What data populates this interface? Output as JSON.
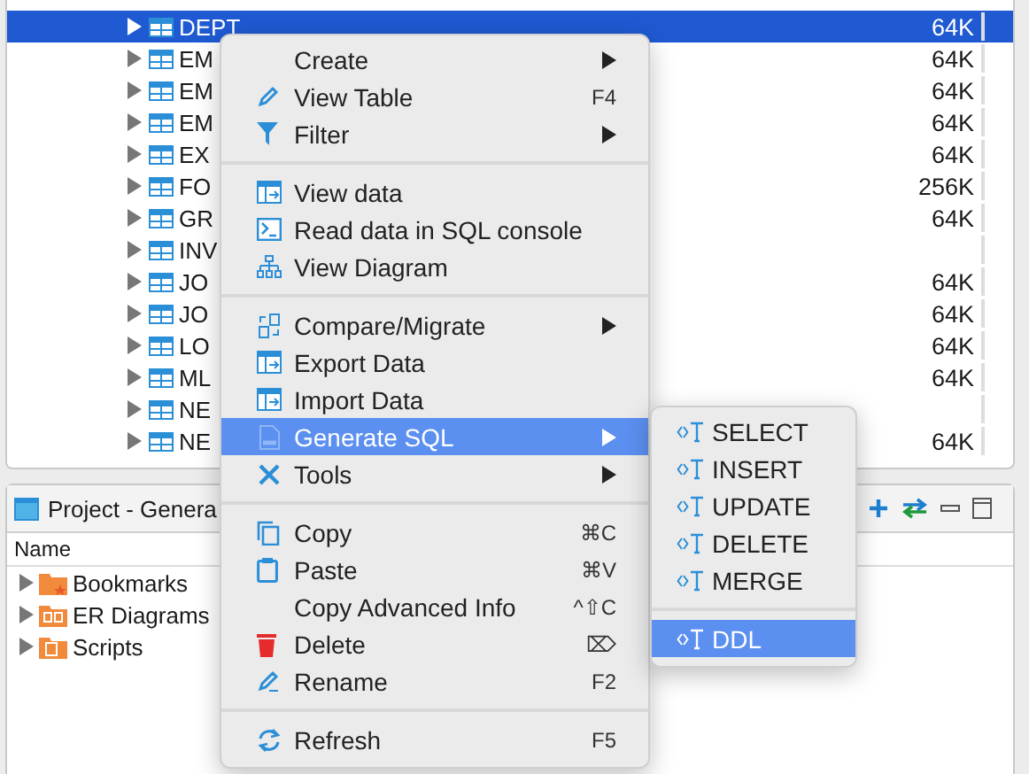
{
  "tables_panel": {
    "rows": [
      {
        "name": "DEPT",
        "size": "64K",
        "selected": true
      },
      {
        "name": "EM",
        "size": "64K",
        "selected": false
      },
      {
        "name": "EM",
        "size": "64K",
        "selected": false
      },
      {
        "name": "EM",
        "size": "64K",
        "selected": false
      },
      {
        "name": "EX",
        "size": "64K",
        "selected": false
      },
      {
        "name": "FO",
        "size": "256K",
        "selected": false
      },
      {
        "name": "GR",
        "size": "64K",
        "selected": false
      },
      {
        "name": "INV",
        "size": "",
        "selected": false
      },
      {
        "name": "JO",
        "size": "64K",
        "selected": false
      },
      {
        "name": "JO",
        "size": "64K",
        "selected": false
      },
      {
        "name": "LO",
        "size": "64K",
        "selected": false
      },
      {
        "name": "ML",
        "size": "64K",
        "selected": false
      },
      {
        "name": "NE",
        "size": "",
        "selected": false
      },
      {
        "name": "NE",
        "size": "64K",
        "selected": false
      }
    ]
  },
  "project_panel": {
    "title": "Project - Genera",
    "column": "Name",
    "items": [
      {
        "label": "Bookmarks"
      },
      {
        "label": "ER Diagrams"
      },
      {
        "label": "Scripts"
      }
    ]
  },
  "context_menu": {
    "items": [
      {
        "kind": "item",
        "label": "Create",
        "submenu": true,
        "selected": false
      },
      {
        "kind": "item",
        "label": "View Table",
        "shortcut": "F4",
        "selected": false
      },
      {
        "kind": "item",
        "label": "Filter",
        "submenu": true,
        "selected": false
      },
      {
        "kind": "separator"
      },
      {
        "kind": "item",
        "label": "View data",
        "selected": false
      },
      {
        "kind": "item",
        "label": "Read data in SQL console",
        "selected": false
      },
      {
        "kind": "item",
        "label": "View Diagram",
        "selected": false
      },
      {
        "kind": "separator"
      },
      {
        "kind": "item",
        "label": "Compare/Migrate",
        "submenu": true,
        "selected": false
      },
      {
        "kind": "item",
        "label": "Export Data",
        "selected": false
      },
      {
        "kind": "item",
        "label": "Import Data",
        "selected": false
      },
      {
        "kind": "item",
        "label": "Generate SQL",
        "submenu": true,
        "selected": true
      },
      {
        "kind": "item",
        "label": "Tools",
        "submenu": true,
        "selected": false
      },
      {
        "kind": "separator"
      },
      {
        "kind": "item",
        "label": "Copy",
        "shortcut": "⌘C",
        "selected": false
      },
      {
        "kind": "item",
        "label": "Paste",
        "shortcut": "⌘V",
        "selected": false
      },
      {
        "kind": "item",
        "label": "Copy Advanced Info",
        "shortcut": "^⇧C",
        "selected": false
      },
      {
        "kind": "item",
        "label": "Delete",
        "shortcut": "⌦",
        "selected": false
      },
      {
        "kind": "item",
        "label": "Rename",
        "shortcut": "F2",
        "selected": false
      },
      {
        "kind": "separator"
      },
      {
        "kind": "item",
        "label": "Refresh",
        "shortcut": "F5",
        "selected": false
      }
    ]
  },
  "submenu": {
    "items": [
      {
        "kind": "item",
        "label": "SELECT",
        "selected": false
      },
      {
        "kind": "item",
        "label": "INSERT",
        "selected": false
      },
      {
        "kind": "item",
        "label": "UPDATE",
        "selected": false
      },
      {
        "kind": "item",
        "label": "DELETE",
        "selected": false
      },
      {
        "kind": "item",
        "label": "MERGE",
        "selected": false
      },
      {
        "kind": "separator"
      },
      {
        "kind": "item",
        "label": "DDL",
        "selected": true
      }
    ]
  }
}
